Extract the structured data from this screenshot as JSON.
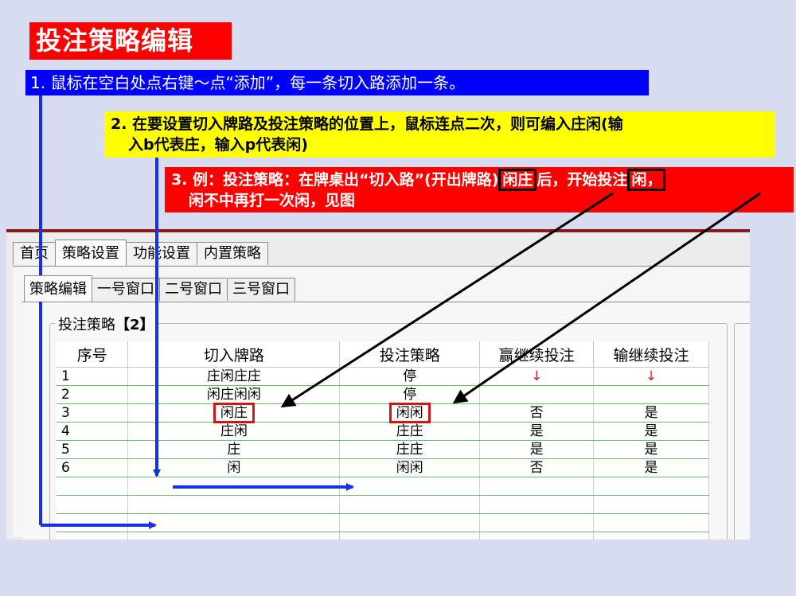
{
  "title": "投注策略编辑",
  "step1": "1. 鼠标在空白处点右键～点“添加”，每一条切入路添加一条。",
  "step2": {
    "line1": "2. 在要设置切入牌路及投注策略的位置上，鼠标连点二次，则可编入庄闲(输",
    "line2": "入b代表庄，输入p代表闲)"
  },
  "step3": {
    "prefix": "3. 例：投注策略：在牌桌出“切入路”(开出牌路)",
    "highlight1": "闲庄",
    "middle": "后，开始投注",
    "highlight2": "闲，",
    "line2": "闲不中再打一次闲，见图"
  },
  "main_tabs": [
    "首页",
    "策略设置",
    "功能设置",
    "内置策略"
  ],
  "sub_tabs": [
    "策略编辑",
    "一号窗口",
    "二号窗口",
    "三号窗口"
  ],
  "group": {
    "label": "投注策略",
    "count": "【2】"
  },
  "table": {
    "headers": [
      "序号",
      "切入牌路",
      "投注策略",
      "赢继续投注",
      "输继续投注"
    ],
    "rows": [
      [
        "1",
        "庄闲庄庄",
        "停",
        "",
        ""
      ],
      [
        "2",
        "闲庄闲闲",
        "停",
        "",
        ""
      ],
      [
        "3",
        "闲庄",
        "闲闲",
        "否",
        "是"
      ],
      [
        "4",
        "庄闲",
        "庄庄",
        "是",
        "是"
      ],
      [
        "5",
        "庄",
        "庄庄",
        "是",
        "是"
      ],
      [
        "6",
        "闲",
        "闲闲",
        "否",
        "是"
      ]
    ]
  },
  "colors": {
    "accent_red": "#ff0000",
    "accent_blue": "#0000ff",
    "accent_yellow": "#ffff00"
  }
}
